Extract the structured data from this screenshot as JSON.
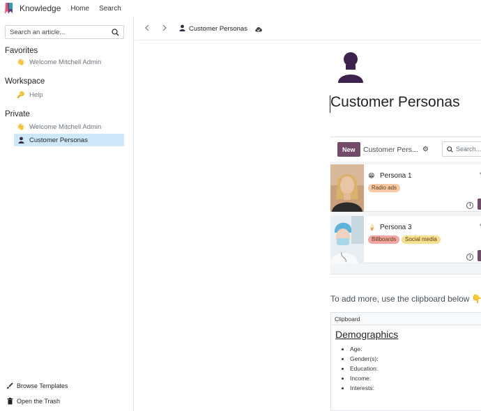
{
  "topbar": {
    "app_name": "Knowledge",
    "nav": [
      "Home",
      "Search"
    ]
  },
  "sidebar": {
    "search_placeholder": "Search an article...",
    "favorites": {
      "title": "Favorites",
      "items": [
        {
          "label": "Welcome Mitchell Admin",
          "icon": "wave-emoji"
        }
      ]
    },
    "workspace": {
      "title": "Workspace",
      "items": [
        {
          "label": "Help",
          "icon": "key-emoji"
        }
      ]
    },
    "private": {
      "title": "Private",
      "items": [
        {
          "label": "Welcome Mitchell Admin",
          "icon": "wave-emoji"
        },
        {
          "label": "Customer Personas",
          "icon": "person-icon",
          "active": true
        }
      ]
    },
    "footer": {
      "browse_templates": "Browse Templates",
      "open_trash": "Open the Trash"
    }
  },
  "header": {
    "breadcrumb": "Customer Personas"
  },
  "article": {
    "title": "Customer Personas",
    "embed": {
      "new_label": "New",
      "name": "Customer Pers...",
      "search_placeholder": "Search..."
    },
    "cards": [
      {
        "name": "Persona 1",
        "emoji": "😁",
        "tags": [
          {
            "label": "Radio ads",
            "color": "#f9c9a8"
          }
        ]
      },
      {
        "name": "Persona 3",
        "emoji": "🍦",
        "tags": [
          {
            "label": "Billboards",
            "color": "#f4a5a5"
          },
          {
            "label": "Social media",
            "color": "#f7e08f"
          }
        ]
      }
    ],
    "hint": "To add more, use the clipboard below 👇",
    "clipboard": {
      "header": "Clipboard",
      "title": "Demographics",
      "fields": [
        "Age:",
        "Gender(s):",
        "Education:",
        "Income:",
        "Interests:"
      ]
    }
  },
  "colors": {
    "brand": "#714b67",
    "active_item": "#cfe8f9"
  }
}
